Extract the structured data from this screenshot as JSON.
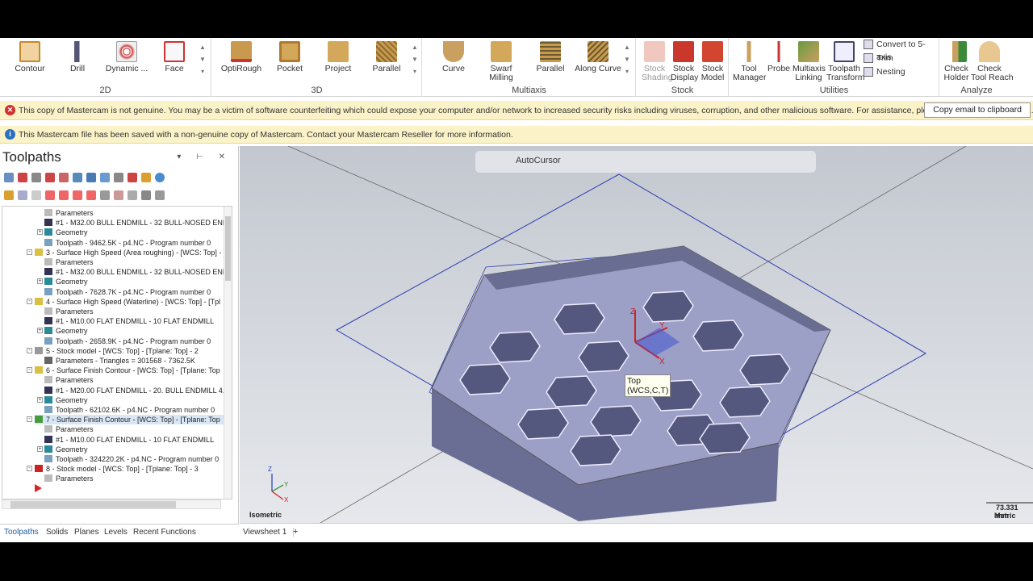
{
  "ribbon": {
    "groups": [
      {
        "label": "2D",
        "buttons": [
          "Contour",
          "Drill",
          "Dynamic ...",
          "Face"
        ]
      },
      {
        "label": "3D",
        "buttons": [
          "OptiRough",
          "Pocket",
          "Project",
          "Parallel"
        ]
      },
      {
        "label": "Multiaxis",
        "buttons": [
          "Curve",
          "Swarf Milling",
          "Parallel",
          "Along Curve"
        ]
      },
      {
        "label": "Stock",
        "buttons": [
          "Stock\nShading",
          "Stock\nDisplay",
          "Stock\nModel"
        ]
      },
      {
        "label": "Utilities",
        "buttons": [
          "Tool\nManager",
          "Probe",
          "Multiaxis\nLinking",
          "Toolpath\nTransform"
        ],
        "small": [
          "Convert to 5-axis",
          "Trim",
          "Nesting"
        ]
      },
      {
        "label": "Analyze",
        "buttons": [
          "Check\nHolder",
          "Check\nTool Reach"
        ]
      }
    ]
  },
  "warnings": {
    "genuine": "This copy of Mastercam is not genuine.  You may be a victim of software counterfeiting which could expose your computer and/or network to increased security risks including viruses, corruption, and other malicious software. For assistance, please email Mastercam at ge...",
    "copy_button": "Copy email to clipboard",
    "file": "This Mastercam file has been saved with a non-genuine copy of Mastercam. Contact your Mastercam Reseller for more information."
  },
  "panel": {
    "title": "Toolpaths",
    "tree": [
      {
        "indent": 2,
        "icon": "folder",
        "text": "Parameters"
      },
      {
        "indent": 2,
        "icon": "tool",
        "text": "#1 - M32.00 BULL ENDMILL - 32 BULL-NOSED ENDMI"
      },
      {
        "indent": 2,
        "icon": "geometry",
        "text": "Geometry",
        "exp": "+"
      },
      {
        "indent": 2,
        "icon": "toolpath",
        "text": "Toolpath - 9462.5K - p4.NC - Program number 0"
      },
      {
        "indent": 1,
        "icon": "op",
        "text": "3 - Surface High Speed (Area roughing) - [WCS: Top] -",
        "exp": "-"
      },
      {
        "indent": 2,
        "icon": "folder",
        "text": "Parameters"
      },
      {
        "indent": 2,
        "icon": "tool",
        "text": "#1 - M32.00 BULL ENDMILL - 32 BULL-NOSED ENDMI"
      },
      {
        "indent": 2,
        "icon": "geometry",
        "text": "Geometry",
        "exp": "+"
      },
      {
        "indent": 2,
        "icon": "toolpath",
        "text": "Toolpath - 7628.7K - p4.NC - Program number 0"
      },
      {
        "indent": 1,
        "icon": "op",
        "text": "4 - Surface High Speed (Waterline) - [WCS: Top] - [Tpl",
        "exp": "-"
      },
      {
        "indent": 2,
        "icon": "folder",
        "text": "Parameters"
      },
      {
        "indent": 2,
        "icon": "tool",
        "text": "#1 - M10.00 FLAT ENDMILL - 10 FLAT ENDMILL"
      },
      {
        "indent": 2,
        "icon": "geometry",
        "text": "Geometry",
        "exp": "+"
      },
      {
        "indent": 2,
        "icon": "toolpath",
        "text": "Toolpath - 2658.9K - p4.NC - Program number 0"
      },
      {
        "indent": 1,
        "icon": "stock",
        "text": "5 - Stock model - [WCS: Top] - [Tplane: Top] - 2",
        "exp": "-"
      },
      {
        "indent": 2,
        "icon": "params",
        "text": "Parameters - Triangles =  301568 - 7362.5K"
      },
      {
        "indent": 1,
        "icon": "op",
        "text": "6 - Surface Finish Contour - [WCS: Top] - [Tplane: Top",
        "exp": "-"
      },
      {
        "indent": 2,
        "icon": "folder",
        "text": "Parameters"
      },
      {
        "indent": 2,
        "icon": "tool",
        "text": "#1 - M20.00 FLAT ENDMILL -    20. BULL ENDMILL 4."
      },
      {
        "indent": 2,
        "icon": "geometry",
        "text": "Geometry",
        "exp": "+"
      },
      {
        "indent": 2,
        "icon": "toolpath",
        "text": "Toolpath - 62102.6K - p4.NC - Program number 0"
      },
      {
        "indent": 1,
        "icon": "op-green",
        "text": "7 - Surface Finish Contour - [WCS: Top] - [Tplane: Top",
        "exp": "-",
        "selected": true
      },
      {
        "indent": 2,
        "icon": "folder",
        "text": "Parameters"
      },
      {
        "indent": 2,
        "icon": "tool",
        "text": "#1 - M10.00 FLAT ENDMILL - 10 FLAT ENDMILL"
      },
      {
        "indent": 2,
        "icon": "geometry",
        "text": "Geometry",
        "exp": "+"
      },
      {
        "indent": 2,
        "icon": "toolpath",
        "text": "Toolpath - 324220.2K - p4.NC - Program number 0"
      },
      {
        "indent": 1,
        "icon": "stock-x",
        "text": "8 - Stock model - [WCS: Top] - [Tplane: Top] - 3",
        "exp": "-"
      },
      {
        "indent": 2,
        "icon": "folder",
        "text": "Parameters"
      },
      {
        "indent": 1,
        "icon": "insert-arrow",
        "text": ""
      }
    ],
    "tabs": [
      "Toolpaths",
      "Solids",
      "Planes",
      "Levels",
      "Recent Functions"
    ]
  },
  "viewport": {
    "autocursor": "AutoCursor",
    "view_name": "Isometric",
    "tooltip": [
      "Top",
      "(WCS,C,T)"
    ],
    "scale_value": "73.331 mm",
    "units": "Metric",
    "axis_labels": {
      "x": "X",
      "y": "Y",
      "z": "Z"
    }
  },
  "viewsheet": {
    "tab": "Viewsheet 1",
    "add": "+"
  },
  "colors": {
    "warn_bg": "#fbf2c8",
    "accent": "#1f6fc5",
    "part": "#8b8fb8"
  }
}
